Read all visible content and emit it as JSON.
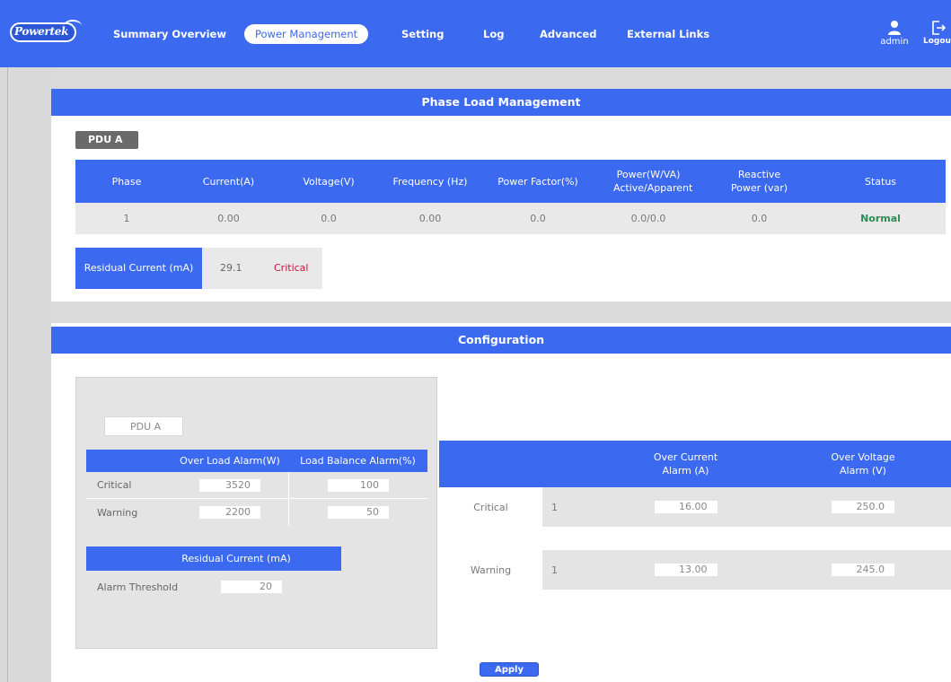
{
  "brand": {
    "logo_text": "Powertek"
  },
  "nav": {
    "items": [
      {
        "label": "Summary Overview",
        "active": false
      },
      {
        "label": "Power Management",
        "active": true
      },
      {
        "label": "Setting",
        "active": false
      },
      {
        "label": "Log",
        "active": false
      },
      {
        "label": "Advanced",
        "active": false
      },
      {
        "label": "External Links",
        "active": false
      }
    ],
    "user_label": "admin",
    "logout_label": "Logout"
  },
  "phase_section": {
    "title": "Phase Load Management",
    "pdu_label": "PDU A",
    "headers": [
      "Phase",
      "Current(A)",
      "Voltage(V)",
      "Frequency (Hz)",
      "Power Factor(%)",
      "Power(W/VA) Active/Apparent",
      "Reactive Power (var)",
      "Status"
    ],
    "rows": [
      [
        "1",
        "0.00",
        "0.0",
        "0.00",
        "0.0",
        "0.0/0.0",
        "0.0",
        "Normal"
      ]
    ],
    "residual": {
      "label": "Residual Current (mA)",
      "value": "29.1",
      "status": "Critical"
    }
  },
  "config_section": {
    "title": "Configuration",
    "pdu_label": "PDU A",
    "load_table": {
      "headers": [
        "",
        "Over Load Alarm(W)",
        "Load Balance Alarm(%)"
      ],
      "rows": [
        {
          "label": "Critical",
          "over_load": "3520",
          "balance": "100"
        },
        {
          "label": "Warning",
          "over_load": "2200",
          "balance": "50"
        }
      ]
    },
    "residual_table": {
      "header": "Residual Current (mA)",
      "row_label": "Alarm Threshold",
      "value": "20"
    },
    "phase_alarm_table": {
      "headers": [
        "",
        "",
        "Over Current Alarm (A)",
        "Over Voltage Alarm (V)"
      ],
      "rows": [
        {
          "label": "Critical",
          "index": "1",
          "current": "16.00",
          "voltage": "250.0"
        },
        {
          "label": "Warning",
          "index": "1",
          "current": "13.00",
          "voltage": "245.0"
        }
      ]
    },
    "apply_label": "Apply"
  },
  "colors": {
    "accent": "#3b69f0",
    "normal": "#2e8b57",
    "critical": "#c0143c"
  }
}
